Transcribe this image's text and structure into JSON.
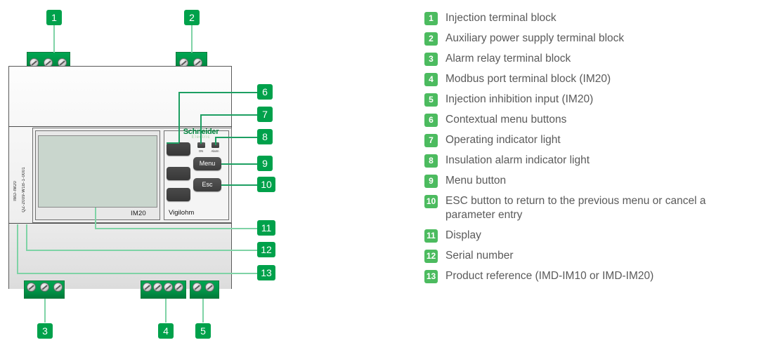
{
  "device": {
    "brand_line1": "Schneider",
    "brand_line2": "Electric",
    "product_family": "Vigilohm",
    "display_model_label": "IM20",
    "product_reference": "IMD-IM20",
    "serial_number": "QZ-2009-W1B-1-0001",
    "led_on_label": "ON",
    "led_alarm_label": "Alarm",
    "menu_button_label": "Menu",
    "esc_button_label": "Esc"
  },
  "callouts": [
    {
      "id": "1",
      "number": "1"
    },
    {
      "id": "2",
      "number": "2"
    },
    {
      "id": "3",
      "number": "3"
    },
    {
      "id": "4",
      "number": "4"
    },
    {
      "id": "5",
      "number": "5"
    },
    {
      "id": "6",
      "number": "6"
    },
    {
      "id": "7",
      "number": "7"
    },
    {
      "id": "8",
      "number": "8"
    },
    {
      "id": "9",
      "number": "9"
    },
    {
      "id": "10",
      "number": "10"
    },
    {
      "id": "11",
      "number": "11"
    },
    {
      "id": "12",
      "number": "12"
    },
    {
      "id": "13",
      "number": "13"
    }
  ],
  "legend": [
    {
      "number": "1",
      "text": "Injection terminal block"
    },
    {
      "number": "2",
      "text": "Auxiliary power supply terminal block"
    },
    {
      "number": "3",
      "text": "Alarm relay terminal block"
    },
    {
      "number": "4",
      "text": "Modbus port terminal block (IM20)"
    },
    {
      "number": "5",
      "text": "Injection inhibition input (IM20)"
    },
    {
      "number": "6",
      "text": "Contextual menu buttons"
    },
    {
      "number": "7",
      "text": "Operating indicator light"
    },
    {
      "number": "8",
      "text": "Insulation alarm indicator light"
    },
    {
      "number": "9",
      "text": "Menu button"
    },
    {
      "number": "10",
      "text": "ESC button to return to the previous menu or cancel a parameter entry"
    },
    {
      "number": "11",
      "text": "Display"
    },
    {
      "number": "12",
      "text": "Serial number"
    },
    {
      "number": "13",
      "text": "Product reference (IMD-IM10 or IMD-IM20)"
    }
  ],
  "colors": {
    "callout_green": "#00a14b",
    "legend_green": "#4cbb5f",
    "terminal_green": "#00a651",
    "leader_green": "#7fd3a6",
    "brand_green": "#00843d",
    "lcd_green": "#c9d6cd"
  }
}
